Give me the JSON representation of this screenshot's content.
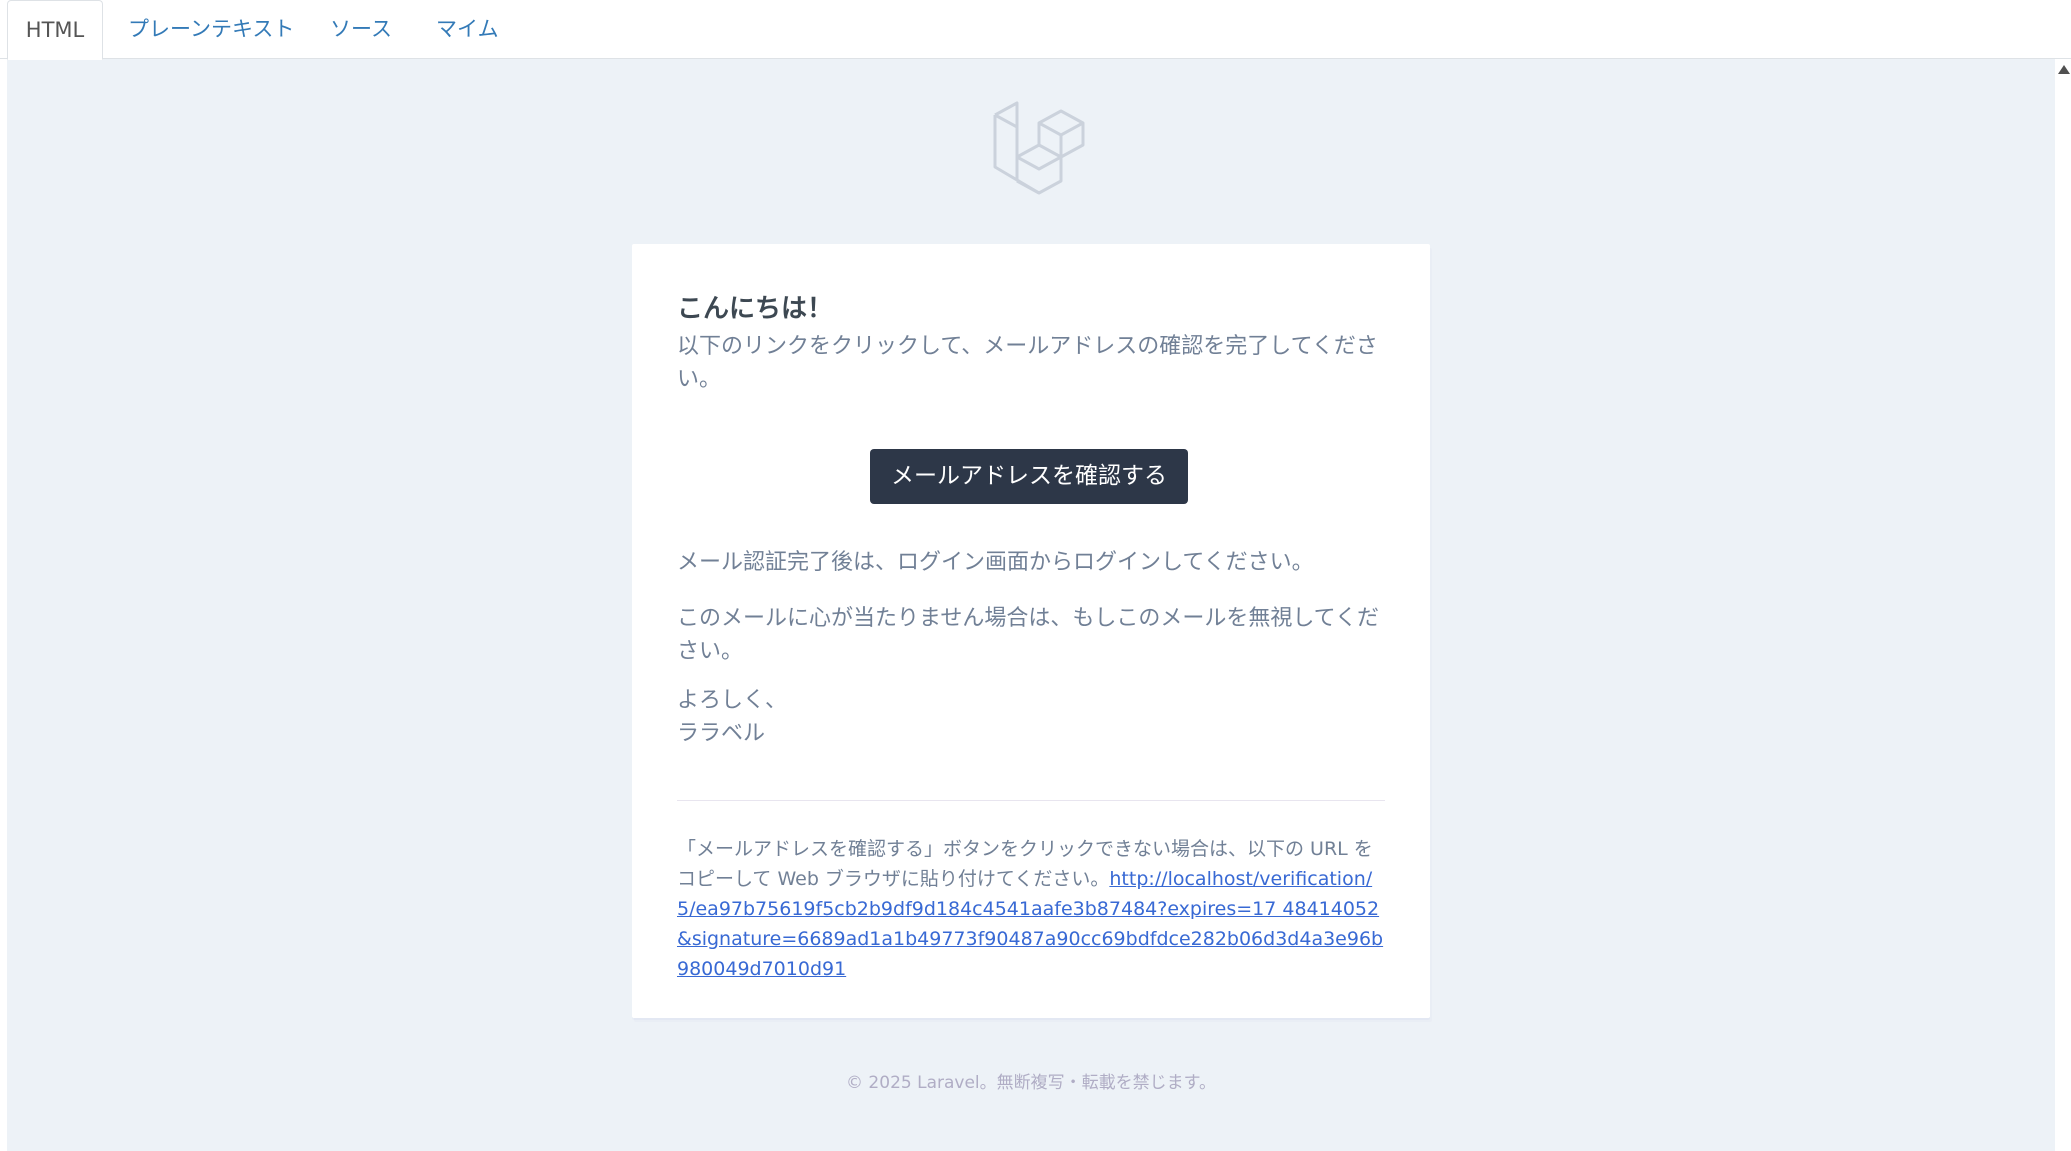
{
  "tabs": [
    {
      "label": "HTML",
      "active": true
    },
    {
      "label": "プレーンテキスト",
      "active": false
    },
    {
      "label": "ソース",
      "active": false
    },
    {
      "label": "マイム",
      "active": false
    }
  ],
  "email": {
    "logo_icon": "laravel-logo-icon",
    "greeting": "こんにちは！",
    "intro": "以下のリンクをクリックして、メールアドレスの確認を完了してください。",
    "button_label": "メールアドレスを確認する",
    "after_login": "メール認証完了後は、ログイン画面からログインしてください。",
    "ignore_note": "このメールに心が当たりません場合は、もしこのメールを無視してください。",
    "salutation_line1": "よろしく、",
    "salutation_line2": "ララベル",
    "subcopy_text": "「メールアドレスを確認する」ボタンをクリックできない場合は、以下の URL をコピーして Web ブラウザに貼り付けてください。",
    "verification_url": "http://localhost/verification/5/ea97b75619f5cb2b9df9d184c4541aafe3b87484?expires=17 48414052&signature=6689ad1a1b49773f90487a90cc69bdfdce282b06d3d4a3e96b980049d7010d91"
  },
  "footer": {
    "copyright": "© 2025 Laravel。無断複写・転載を禁じます。"
  },
  "colors": {
    "tab_link": "#337ab7",
    "preview_background": "#edf2f7",
    "button_background": "#2d3748",
    "body_text": "#718096",
    "heading_text": "#3d4852",
    "link": "#3869d4",
    "footer_text": "#b0adc5"
  }
}
